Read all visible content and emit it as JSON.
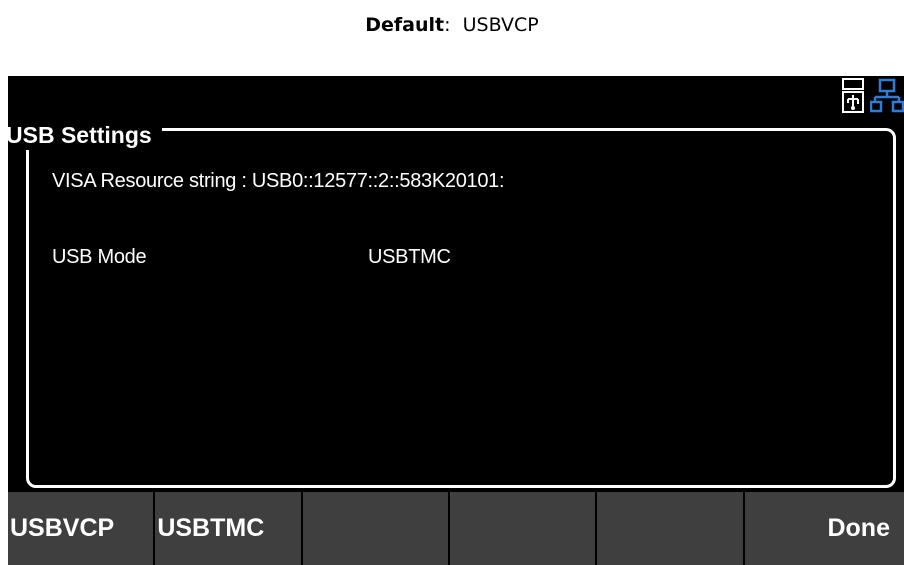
{
  "caption": {
    "label": "Default",
    "separator": ":",
    "value": "USBVCP"
  },
  "status_bar": {
    "icons": [
      "usb-icon",
      "network-icon"
    ],
    "network_color": "#2f7bd8"
  },
  "panel": {
    "title": "USB Settings",
    "visa_line": "VISA Resource string : USB0::12577::2::583K20101:",
    "usb_mode_label": "USB Mode",
    "usb_mode_value": "USBTMC"
  },
  "softkeys": [
    {
      "label": "USBVCP"
    },
    {
      "label": "USBTMC"
    },
    {
      "label": ""
    },
    {
      "label": ""
    },
    {
      "label": ""
    },
    {
      "label": "Done"
    }
  ],
  "colors": {
    "screen_bg": "#000000",
    "softkey_bg": "#3f3f3f",
    "text": "#ffffff"
  }
}
